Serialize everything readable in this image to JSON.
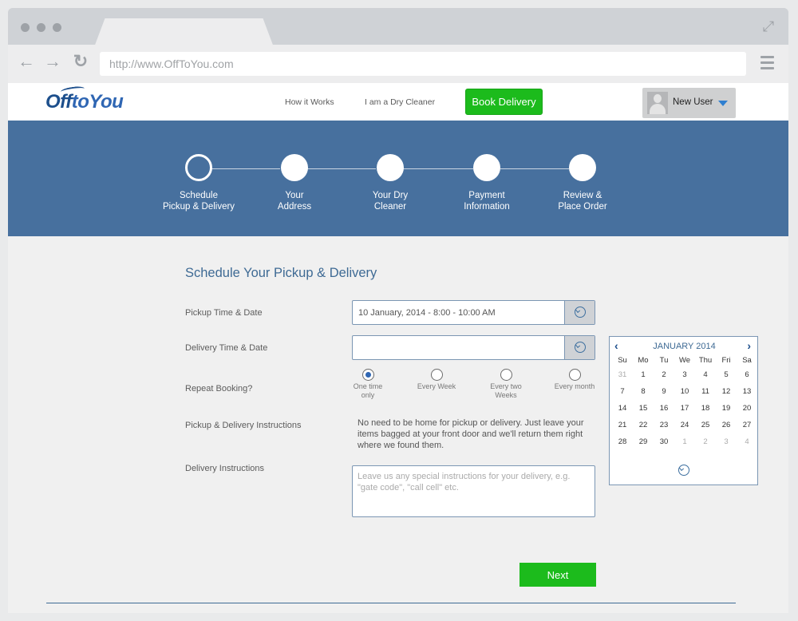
{
  "browser": {
    "url": "http://www.OffToYou.com"
  },
  "header": {
    "logo_part1": "Off",
    "logo_part2": "toYou",
    "nav": [
      "How it Works",
      "I am a Dry Cleaner"
    ],
    "book_label": "Book Delivery",
    "user_name": "New User"
  },
  "steps": [
    {
      "label": "Schedule\nPickup & Delivery",
      "active": true
    },
    {
      "label": "Your\nAddress",
      "active": false
    },
    {
      "label": "Your Dry\nCleaner",
      "active": false
    },
    {
      "label": "Payment\nInformation",
      "active": false
    },
    {
      "label": "Review &\nPlace Order",
      "active": false
    }
  ],
  "form": {
    "title": "Schedule Your Pickup & Delivery",
    "pickup_label": "Pickup Time & Date",
    "pickup_value": "10 January, 2014 - 8:00 - 10:00 AM",
    "delivery_label": "Delivery Time & Date",
    "delivery_value": "",
    "repeat_label": "Repeat Booking?",
    "repeat_options": [
      {
        "label": "One time only",
        "selected": true
      },
      {
        "label": "Every Week",
        "selected": false
      },
      {
        "label": "Every two Weeks",
        "selected": false
      },
      {
        "label": "Every month",
        "selected": false
      }
    ],
    "instructions_label": "Pickup & Delivery Instructions",
    "instructions_text": "No need to be home for pickup or delivery. Just leave your items bagged at your front door and we'll return them right where we found them.",
    "delivery_instr_label": "Delivery Instructions",
    "delivery_instr_placeholder": "Leave us any special instructions for your delivery, e.g. \"gate code\", \"call cell\" etc.",
    "next_label": "Next"
  },
  "calendar": {
    "month": "JANUARY 2014",
    "days_of_week": [
      "Su",
      "Mo",
      "Tu",
      "We",
      "Thu",
      "Fri",
      "Sa"
    ],
    "weeks": [
      [
        "31",
        "1",
        "2",
        "3",
        "4",
        "5",
        "6"
      ],
      [
        "7",
        "8",
        "9",
        "10",
        "11",
        "12",
        "13"
      ],
      [
        "14",
        "15",
        "16",
        "17",
        "18",
        "19",
        "20"
      ],
      [
        "21",
        "22",
        "23",
        "24",
        "25",
        "26",
        "27"
      ],
      [
        "28",
        "29",
        "30",
        "1",
        "2",
        "3",
        "4"
      ]
    ],
    "muted": [
      [
        0,
        0
      ],
      [
        4,
        3
      ],
      [
        4,
        4
      ],
      [
        4,
        5
      ],
      [
        4,
        6
      ]
    ]
  },
  "colors": {
    "brand_blue": "#47709e",
    "accent_green": "#1cbb1c"
  }
}
